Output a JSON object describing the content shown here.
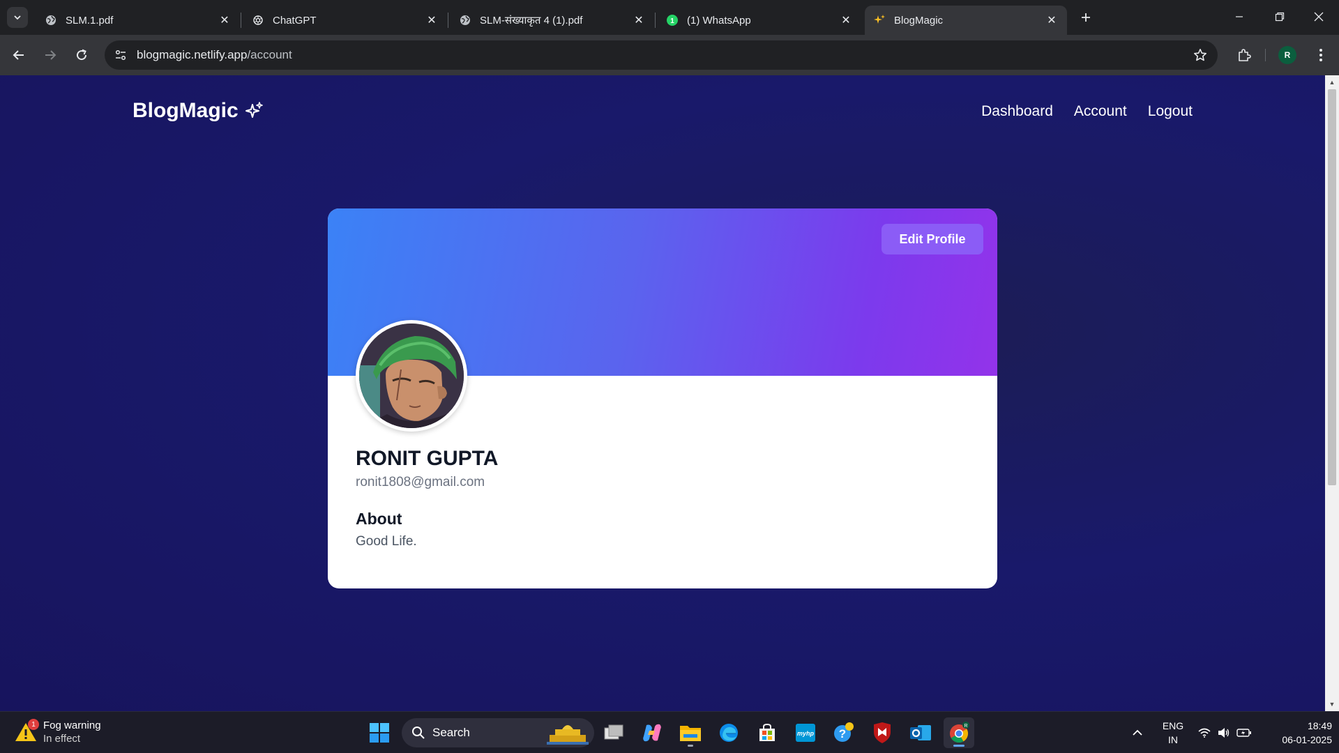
{
  "browser": {
    "tabs": [
      {
        "title": "SLM.1.pdf",
        "icon": "globe-icon"
      },
      {
        "title": "ChatGPT",
        "icon": "chatgpt-icon"
      },
      {
        "title": "SLM-संख्याकृत 4 (1).pdf",
        "icon": "globe-icon"
      },
      {
        "title": "(1) WhatsApp",
        "icon": "whatsapp-icon"
      },
      {
        "title": "BlogMagic",
        "icon": "sparkles-icon",
        "active": true
      }
    ],
    "url": {
      "host": "blogmagic.netlify.app",
      "path": "/account"
    },
    "profile_initial": "R"
  },
  "page": {
    "brand": "BlogMagic",
    "nav": [
      "Dashboard",
      "Account",
      "Logout"
    ],
    "profile": {
      "edit_label": "Edit Profile",
      "name": "RONIT GUPTA",
      "email": "ronit1808@gmail.com",
      "about_heading": "About",
      "about_text": "Good Life."
    }
  },
  "taskbar": {
    "weather": {
      "title": "Fog warning",
      "subtitle": "In effect",
      "badge": "1"
    },
    "search_label": "Search",
    "lang": {
      "line1": "ENG",
      "line2": "IN"
    },
    "time": "18:49",
    "date": "06-01-2025",
    "profile_badge": "R"
  },
  "colors": {
    "banner_start": "#3b82f6",
    "banner_end": "#9333ea",
    "edit_button": "#8b5cf6",
    "page_bg": "#19196a"
  }
}
